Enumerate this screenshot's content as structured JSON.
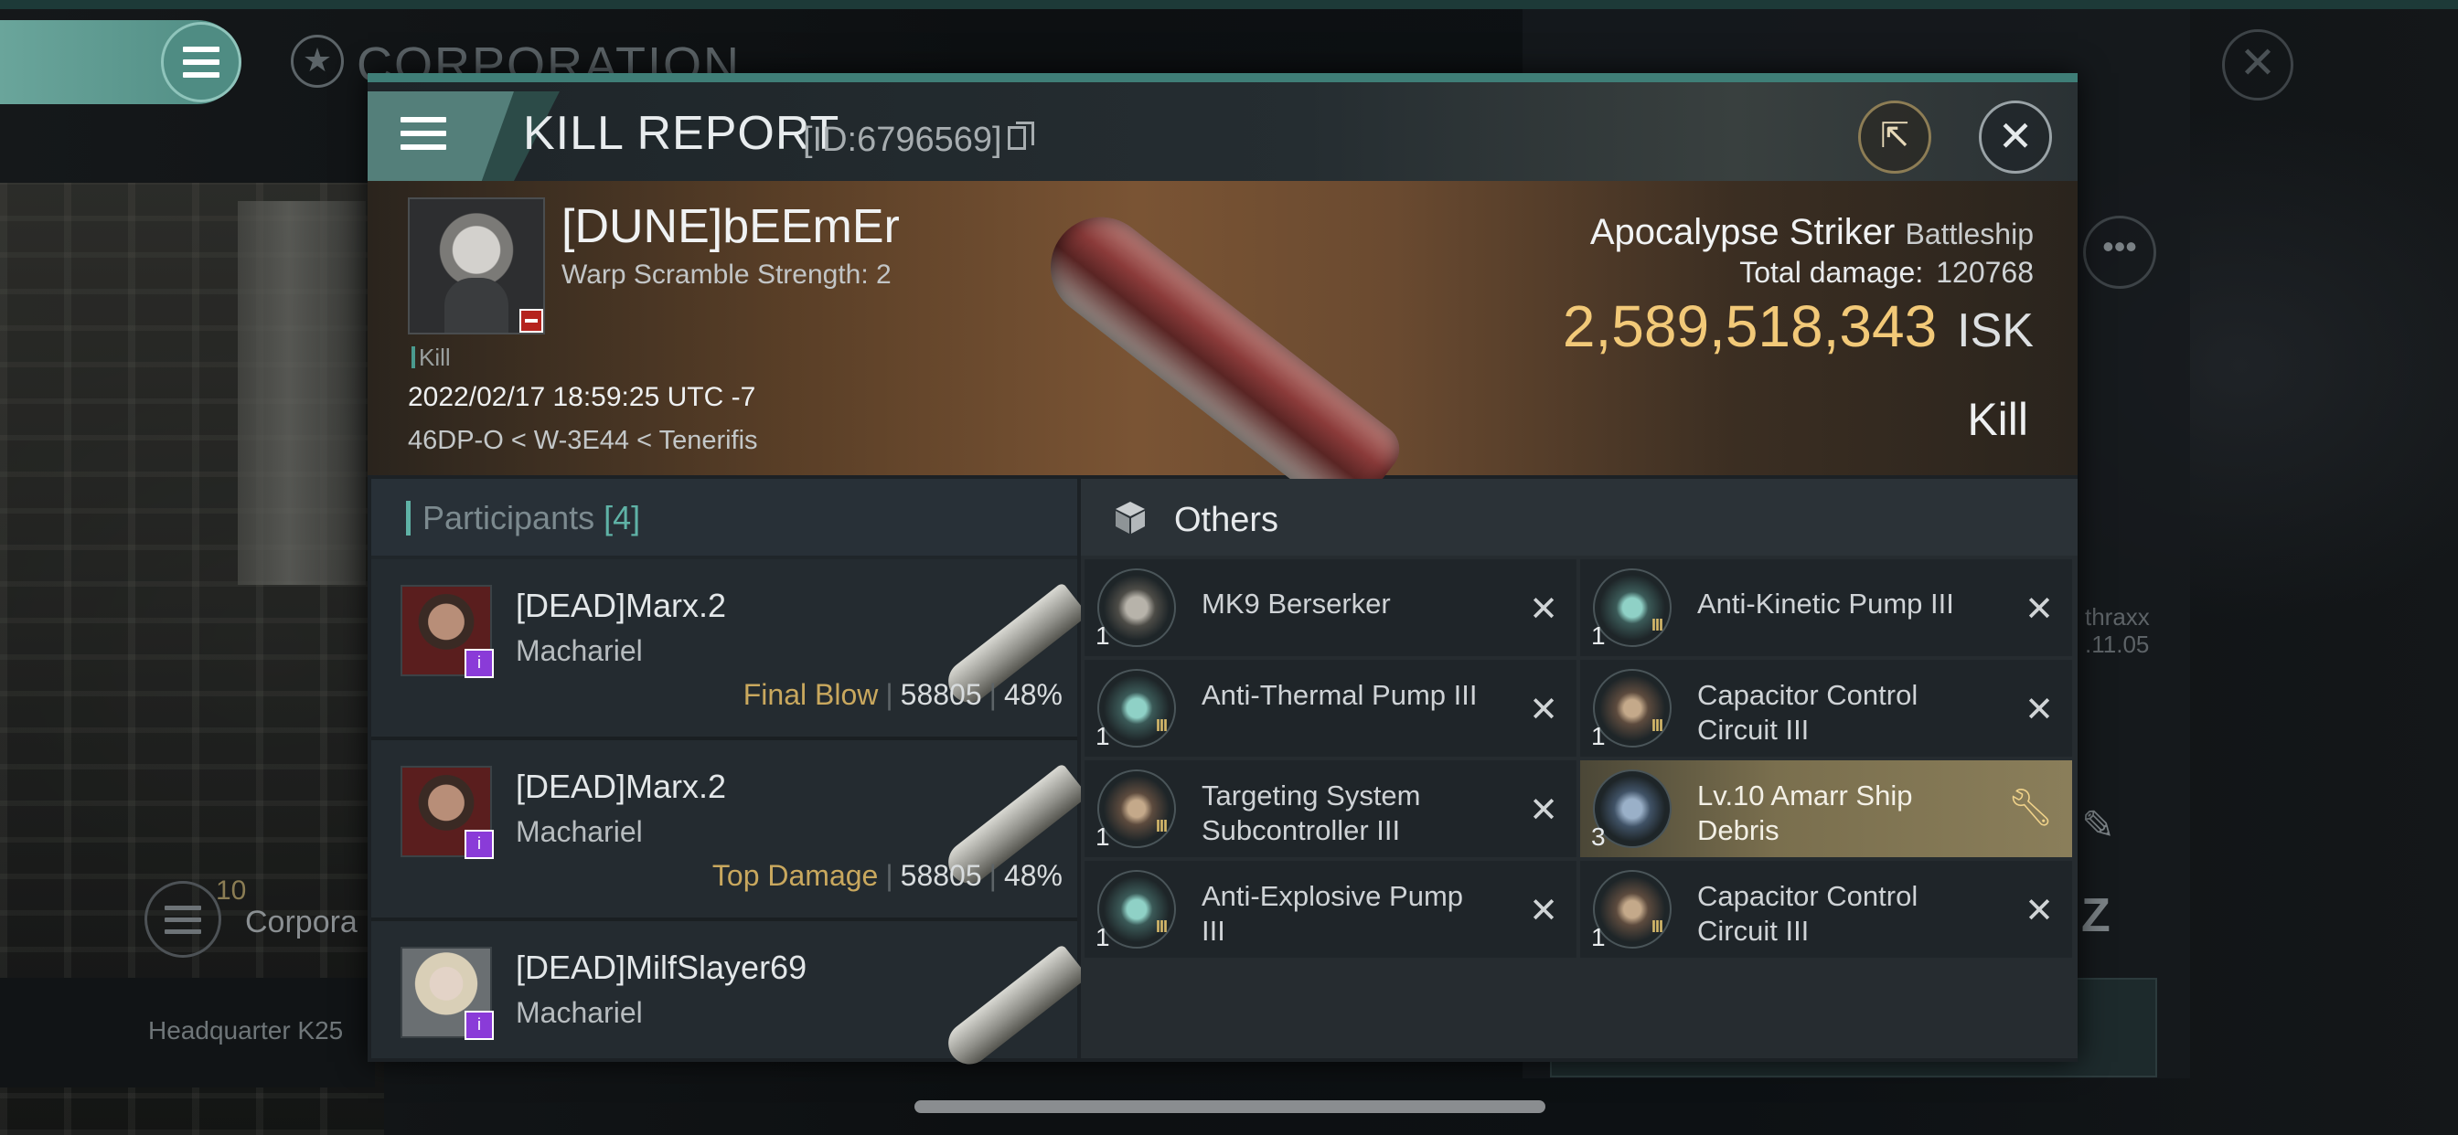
{
  "background": {
    "corp_title": "CORPORATION",
    "corp_count": "10",
    "corp_label": "Corpora",
    "hq_label": "Headquarter K25",
    "side_text_1": "thraxx",
    "side_text_2": ".11.05"
  },
  "dialog": {
    "title": "KILL REPORT",
    "id": "[ID:6796569]"
  },
  "victim": {
    "name": "[DUNE]bEEmEr",
    "subtitle": "Warp Scramble Strength: 2",
    "tag": "Kill",
    "datetime": "2022/02/17 18:59:25 UTC -7",
    "location": "46DP-O < W-3E44 < Tenerifis",
    "ship_name": "Apocalypse Striker",
    "ship_class": "Battleship",
    "total_damage_label": "Total damage:",
    "total_damage": "120768",
    "isk_value": "2,589,518,343",
    "isk_unit": "ISK",
    "result": "Kill"
  },
  "participants": {
    "label": "Participants",
    "count": "[4]",
    "rows": [
      {
        "name": "[DEAD]Marx.2",
        "ship": "Machariel",
        "role": "Final Blow",
        "damage": "58805",
        "percent": "48%"
      },
      {
        "name": "[DEAD]Marx.2",
        "ship": "Machariel",
        "role": "Top Damage",
        "damage": "58805",
        "percent": "48%"
      },
      {
        "name": "[DEAD]MilfSlayer69",
        "ship": "Machariel",
        "role": "",
        "damage": "",
        "percent": ""
      }
    ]
  },
  "others": {
    "label": "Others",
    "items": [
      {
        "name": "MK9  Berserker",
        "qty": "1",
        "tier": "",
        "icon": "drone-icon"
      },
      {
        "name": "Anti-Kinetic Pump III",
        "qty": "1",
        "tier": "III",
        "icon": "pump-icon"
      },
      {
        "name": "Anti-Thermal Pump III",
        "qty": "1",
        "tier": "III",
        "icon": "pump-icon"
      },
      {
        "name": "Capacitor Control Circuit III",
        "qty": "1",
        "tier": "III",
        "icon": "circuit-icon"
      },
      {
        "name": "Targeting System Subcontroller III",
        "qty": "1",
        "tier": "III",
        "icon": "circuit-icon"
      },
      {
        "name": "Lv.10 Amarr Ship Debris",
        "qty": "3",
        "tier": "",
        "icon": "debris-icon"
      },
      {
        "name": "Anti-Explosive Pump III",
        "qty": "1",
        "tier": "III",
        "icon": "pump-icon"
      },
      {
        "name": "Capacitor Control Circuit III",
        "qty": "1",
        "tier": "III",
        "icon": "circuit-icon"
      }
    ]
  },
  "colors": {
    "accent": "#5fb2a6",
    "isk_gold": "#f2c978",
    "highlight": "#8a7e5a"
  }
}
